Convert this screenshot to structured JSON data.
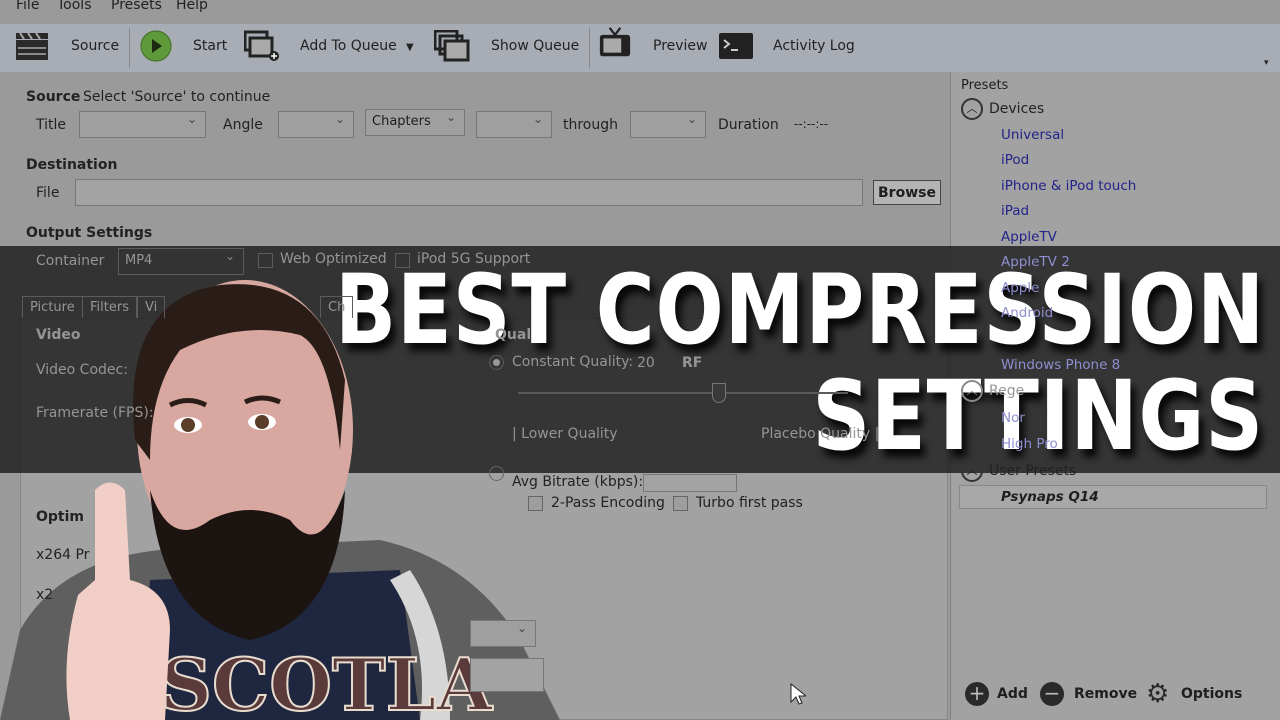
{
  "menu": [
    "File",
    "Tools",
    "Presets",
    "Help"
  ],
  "toolbar": {
    "source": "Source",
    "start": "Start",
    "add_to_queue": "Add To Queue",
    "show_queue": "Show Queue",
    "preview": "Preview",
    "activity_log": "Activity Log"
  },
  "source": {
    "heading": "Source",
    "status": "Select 'Source' to continue",
    "title_label": "Title",
    "angle_label": "Angle",
    "chapters_value": "Chapters",
    "through_label": "through",
    "duration_label": "Duration",
    "duration_value": "--:--:--"
  },
  "destination": {
    "heading": "Destination",
    "file_label": "File",
    "file_value": "",
    "browse": "Browse"
  },
  "output": {
    "heading": "Output Settings",
    "container_label": "Container",
    "container_value": "MP4",
    "web_optimized": "Web Optimized",
    "ipod": "iPod 5G Support"
  },
  "tabs": [
    "Picture",
    "Filters",
    "Vi",
    "Ch"
  ],
  "video": {
    "heading": "Video",
    "codec_label": "Video Codec:",
    "fps_label": "Framerate (FPS):",
    "optimise": "Optim",
    "x264_preset": "x264 Pr",
    "x264_2": "x2"
  },
  "quality": {
    "heading": "Qual",
    "cq_label": "Constant Quality:",
    "cq_value": "20",
    "cq_unit": "RF",
    "lower": "| Lower Quality",
    "placebo": "Placebo Quality |",
    "avg_bitrate": "Avg Bitrate (kbps):",
    "two_pass": "2-Pass Encoding",
    "turbo": "Turbo first pass",
    "slider_value": 20
  },
  "presets": {
    "title": "Presets",
    "devices": "Devices",
    "device_items": [
      "Universal",
      "iPod",
      "iPhone & iPod touch",
      "iPad",
      "AppleTV",
      "AppleTV 2",
      "Apple",
      "Android",
      "Windows Phone 8"
    ],
    "regular": "Rege",
    "regular_items": [
      "Nor",
      "High Pro"
    ],
    "user": "User Presets",
    "user_item": "Psynaps Q14",
    "add": "Add",
    "remove": "Remove",
    "options": "Options"
  },
  "headline": {
    "line1": "BEST COMPRESSION",
    "line2": "SETTINGS"
  }
}
